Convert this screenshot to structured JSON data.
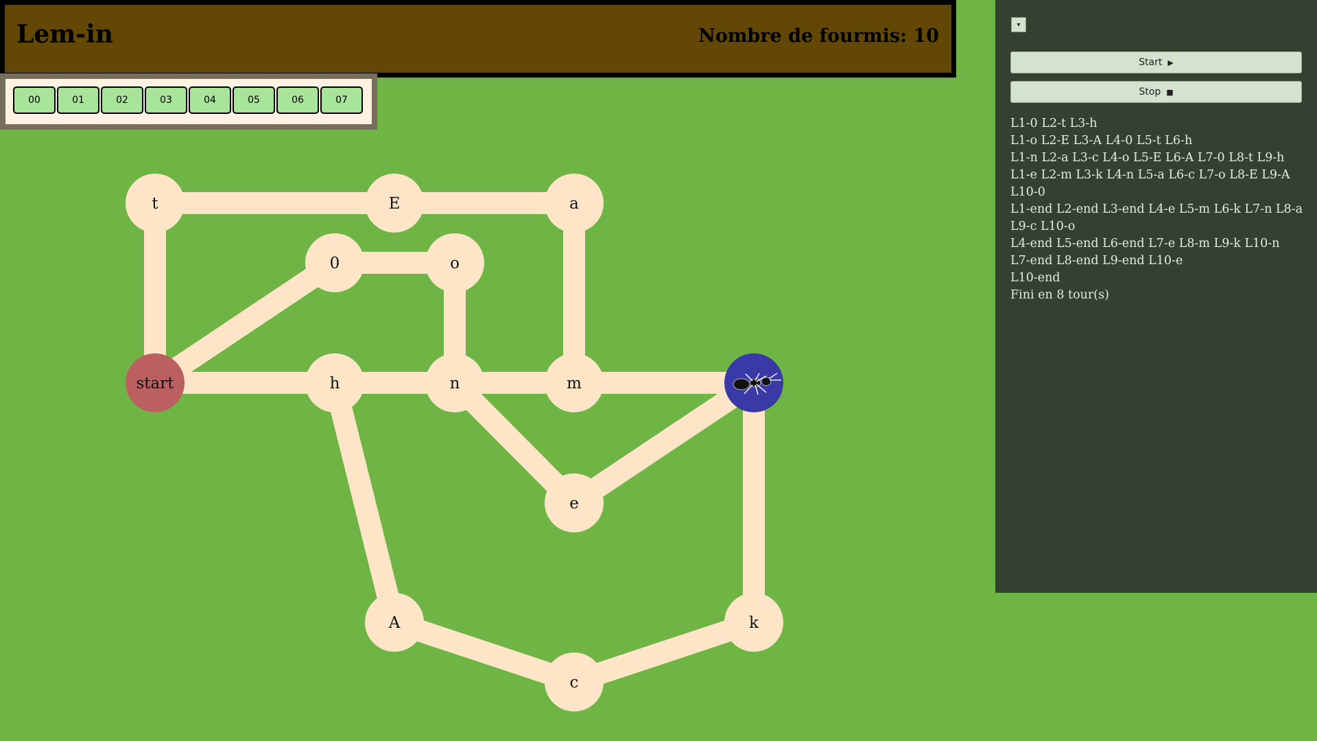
{
  "header": {
    "title": "Lem-in",
    "ant_count_label": "Nombre de fourmis: 10"
  },
  "turns": [
    "00",
    "01",
    "02",
    "03",
    "04",
    "05",
    "06",
    "07"
  ],
  "sidebar": {
    "collapse_icon": "▾",
    "start_label": "Start",
    "start_icon": "▶",
    "stop_label": "Stop",
    "stop_icon": "■",
    "log_lines": [
      "L1-0 L2-t L3-h",
      "L1-o L2-E L3-A L4-0 L5-t L6-h",
      "L1-n L2-a L3-c L4-o L5-E L6-A L7-0 L8-t L9-h",
      "L1-e L2-m L3-k L4-n L5-a L6-c L7-o L8-E L9-A L10-0",
      "L1-end L2-end L3-end L4-e L5-m L6-k L7-n L8-a L9-c L10-o",
      "L4-end L5-end L6-end L7-e L8-m L9-k L10-n",
      "L7-end L8-end L9-end L10-e",
      "L10-end",
      "Fini en 8 tour(s)"
    ]
  },
  "graph": {
    "nodes": [
      {
        "id": "t",
        "label": "t",
        "type": "room"
      },
      {
        "id": "E",
        "label": "E",
        "type": "room"
      },
      {
        "id": "a",
        "label": "a",
        "type": "room"
      },
      {
        "id": "0",
        "label": "0",
        "type": "room"
      },
      {
        "id": "o",
        "label": "o",
        "type": "room"
      },
      {
        "id": "start",
        "label": "start",
        "type": "start"
      },
      {
        "id": "h",
        "label": "h",
        "type": "room"
      },
      {
        "id": "n",
        "label": "n",
        "type": "room"
      },
      {
        "id": "m",
        "label": "m",
        "type": "room"
      },
      {
        "id": "end",
        "label": "",
        "type": "end"
      },
      {
        "id": "e",
        "label": "e",
        "type": "room"
      },
      {
        "id": "A",
        "label": "A",
        "type": "room"
      },
      {
        "id": "k",
        "label": "k",
        "type": "room"
      },
      {
        "id": "c",
        "label": "c",
        "type": "room"
      }
    ],
    "links": [
      [
        "t",
        "E"
      ],
      [
        "E",
        "a"
      ],
      [
        "t",
        "start"
      ],
      [
        "a",
        "m"
      ],
      [
        "0",
        "o"
      ],
      [
        "0",
        "start"
      ],
      [
        "o",
        "n"
      ],
      [
        "start",
        "h"
      ],
      [
        "h",
        "n"
      ],
      [
        "n",
        "m"
      ],
      [
        "m",
        "end"
      ],
      [
        "n",
        "e"
      ],
      [
        "e",
        "end"
      ],
      [
        "h",
        "A"
      ],
      [
        "end",
        "k"
      ],
      [
        "A",
        "c"
      ],
      [
        "c",
        "k"
      ]
    ],
    "colors": {
      "room": "#fee5c7",
      "start": "#bc5f60",
      "end": "#3a3aa6",
      "link": "#fee5c7"
    },
    "ant_icon": "ant-icon"
  }
}
